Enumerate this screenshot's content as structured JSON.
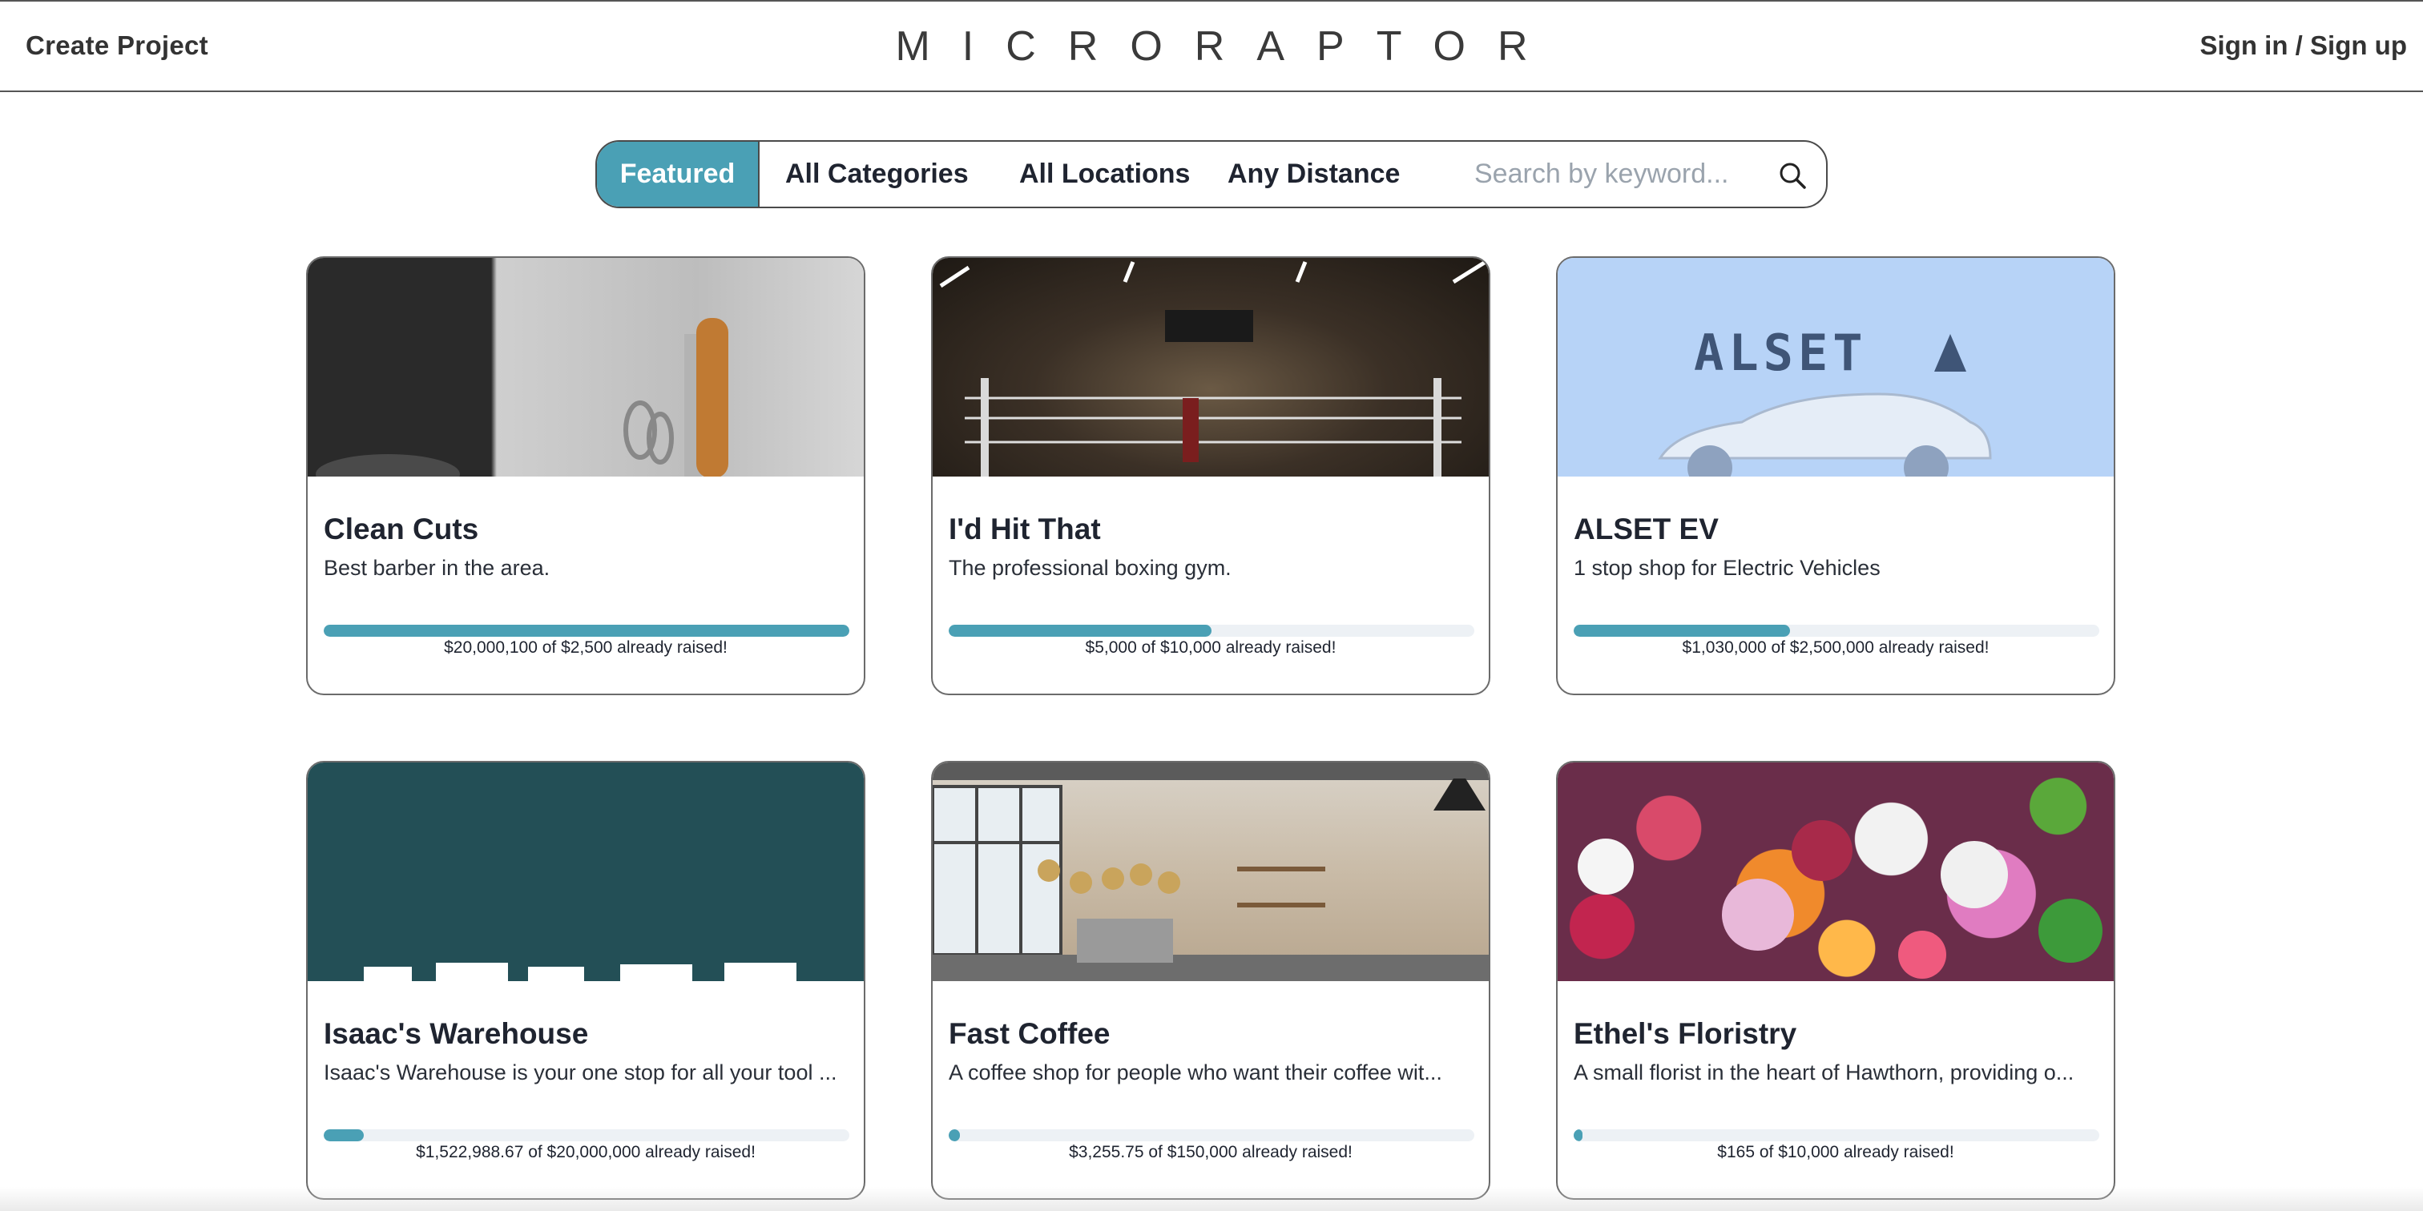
{
  "header": {
    "create_project": "Create Project",
    "brand": "MICRORAPTOR",
    "signin": "Sign in / Sign up"
  },
  "filters": {
    "featured": "Featured",
    "categories": "All Categories",
    "locations": "All Locations",
    "distance": "Any Distance",
    "search_placeholder": "Search by keyword...",
    "search_icon": "search-icon"
  },
  "colors": {
    "accent": "#4aa0b5",
    "track": "#edf1f5"
  },
  "cards": [
    {
      "title": "Clean Cuts",
      "description": "Best barber in the area.",
      "raised_text": "$20,000,100 of $2,500 already raised!",
      "progress": 1.0
    },
    {
      "title": "I'd Hit That",
      "description": "The professional boxing gym.",
      "raised_text": "$5,000 of $10,000 already raised!",
      "progress": 0.5
    },
    {
      "title": "ALSET EV",
      "description": "1 stop shop for Electric Vehicles",
      "raised_text": "$1,030,000 of $2,500,000 already raised!",
      "progress": 0.412,
      "image_text": "ALSET"
    },
    {
      "title": "Isaac's Warehouse",
      "description": "Isaac's Warehouse is your one stop for all your tool ...",
      "raised_text": "$1,522,988.67 of $20,000,000 already raised!",
      "progress": 0.076
    },
    {
      "title": "Fast Coffee",
      "description": "A coffee shop for people who want their coffee wit...",
      "raised_text": "$3,255.75 of $150,000 already raised!",
      "progress": 0.022
    },
    {
      "title": "Ethel's Floristry",
      "description": "A small florist in the heart of Hawthorn, providing o...",
      "raised_text": "$165 of $10,000 already raised!",
      "progress": 0.0165
    }
  ]
}
